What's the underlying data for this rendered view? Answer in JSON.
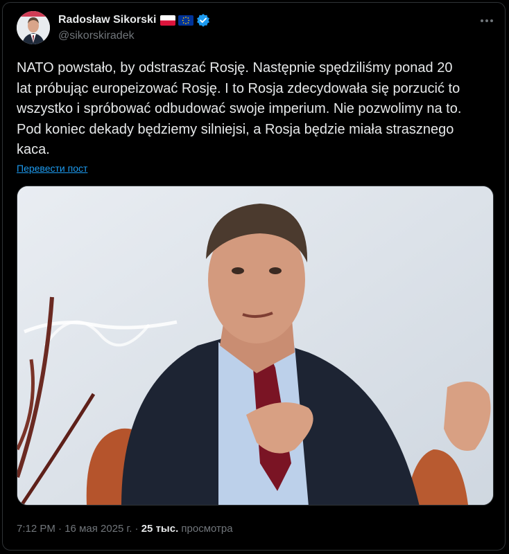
{
  "author": {
    "display_name": "Radosław Sikorski",
    "handle": "@sikorskiradek",
    "badges": [
      "poland-flag-icon",
      "eu-flag-icon",
      "verified-badge-icon"
    ]
  },
  "tweet": {
    "text": "NATO powstało, by odstraszać Rosję. Następnie spędziliśmy ponad 20\nlat próbując europeizować Rosję. I to Rosja zdecydowała się porzucić to\nwszystko i spróbować odbudować swoje imperium. Nie pozwolimy na to.\nPod koniec dekady będziemy silniejsi, a Rosja będzie miała strasznego\nkaca.",
    "translate_link": "Перевести пост"
  },
  "meta": {
    "time": "7:12 PM",
    "separator": "·",
    "date": "16 мая 2025 г.",
    "views_count": "25 тыс.",
    "views_label": "просмотра"
  },
  "colors": {
    "background": "#000000",
    "text": "#e7e9ea",
    "secondary": "#71767b",
    "link": "#1d9bf0",
    "verified": "#1d9bf0"
  }
}
